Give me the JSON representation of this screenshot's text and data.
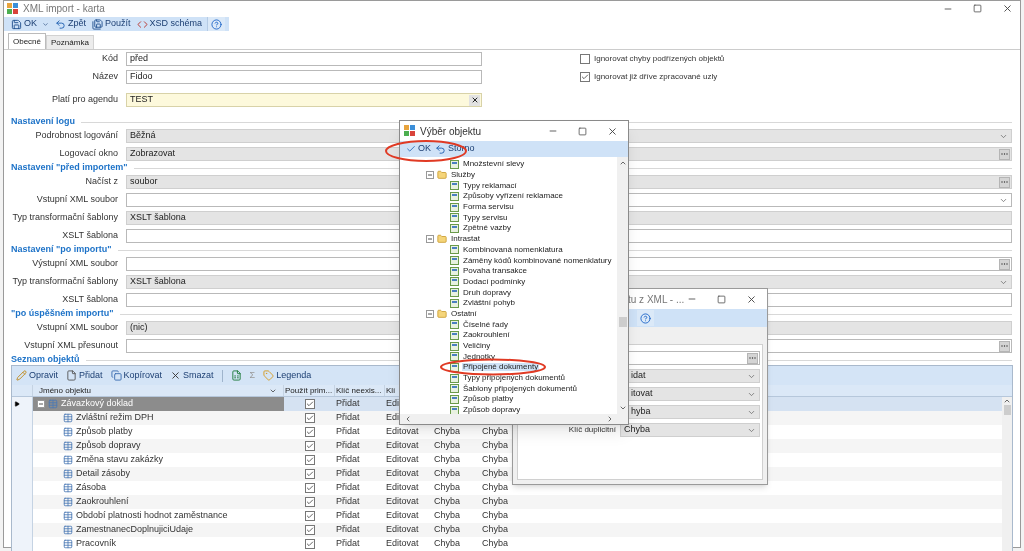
{
  "window": {
    "title": "XML import - karta"
  },
  "toolbar": [
    {
      "kind": "ok",
      "label": "OK",
      "menu": true
    },
    {
      "kind": "back",
      "label": "Zpět"
    },
    {
      "kind": "apply",
      "label": "Použít"
    },
    {
      "kind": "schema",
      "label": "XSD schéma"
    },
    {
      "kind": "help"
    }
  ],
  "tabs": [
    {
      "label": "Obecné",
      "selected": true
    },
    {
      "label": "Poznámka",
      "selected": false
    }
  ],
  "header_fields": [
    {
      "label": "Kód",
      "value": "před",
      "kind": "text"
    },
    {
      "label": "Název",
      "value": "Fidoo",
      "kind": "text"
    },
    {
      "label": "Platí pro agendu",
      "value": "TEST",
      "kind": "agenda"
    }
  ],
  "options": [
    {
      "label": "Ignorovat chyby podřízených objektů",
      "checked": false
    },
    {
      "label": "Ignorovat již dříve zpracované uzly",
      "checked": true
    }
  ],
  "sections": [
    {
      "title": "Nastavení logu",
      "fields": [
        {
          "label": "Podrobnost logování",
          "value": "Běžná",
          "kind": "select",
          "dropdown": true,
          "browse": false
        },
        {
          "label": "Logovací okno",
          "value": "Zobrazovat",
          "kind": "select",
          "dropdown": false,
          "browse": true
        }
      ]
    },
    {
      "title": "Nastavení \"před importem\"",
      "fields": [
        {
          "label": "Načíst z",
          "value": "soubor",
          "kind": "select",
          "dropdown": false,
          "browse": true
        },
        {
          "label": "Vstupní XML soubor",
          "kind": "text",
          "dropdown": true,
          "browse": false
        },
        {
          "label": "Typ transformační šablony",
          "value": "XSLT šablona",
          "kind": "select",
          "dropdown": false,
          "browse": false
        },
        {
          "label": "XSLT šablona",
          "kind": "text",
          "dropdown": false,
          "browse": false
        }
      ]
    },
    {
      "title": "Nastavení \"po importu\"",
      "fields": [
        {
          "label": "Výstupní XML soubor",
          "kind": "text",
          "dropdown": false,
          "browse": true
        },
        {
          "label": "Typ transformační šablony",
          "value": "XSLT šablona",
          "kind": "select",
          "dropdown": true,
          "browse": false
        },
        {
          "label": "XSLT šablona",
          "kind": "text",
          "dropdown": false,
          "browse": false
        }
      ]
    },
    {
      "title": "\"po úspěšném importu\"",
      "fields": [
        {
          "label": "Vstupní XML soubor",
          "value": "(nic)",
          "kind": "select",
          "dropdown": false,
          "browse": false
        },
        {
          "label": "Vstupní XML přesunout",
          "kind": "text",
          "dropdown": false,
          "browse": true
        }
      ]
    }
  ],
  "grid": {
    "title": "Seznam objektů",
    "toolbar": [
      {
        "kind": "edit",
        "label": "Opravit"
      },
      {
        "kind": "add",
        "label": "Přidat"
      },
      {
        "kind": "copy",
        "label": "Kopírovat"
      },
      {
        "kind": "delete",
        "label": "Smazat"
      },
      {
        "kind": "excel"
      },
      {
        "kind": "sum",
        "label": "Σ"
      },
      {
        "kind": "legend",
        "label": "Legenda"
      }
    ],
    "columns": [
      "Jméno objektu",
      "Použít prim...",
      "Klíč neexis...",
      "Klí"
    ],
    "rows": [
      {
        "selected": true,
        "expanded": true,
        "use": true,
        "cells": [
          "Závazkový doklad",
          "",
          "Přidat",
          "Edi"
        ],
        "children": [
          {
            "selected": false,
            "use": true,
            "cells": [
              "Zvláštní režim DPH",
              "",
              "Přidat",
              "Edi"
            ]
          },
          {
            "selected": false,
            "use": true,
            "cells": [
              "Způsob platby",
              "",
              "Přidat",
              "Editovat",
              "Chyba",
              "Chyba"
            ]
          },
          {
            "selected": false,
            "use": true,
            "cells": [
              "Způsob dopravy",
              "",
              "Přidat",
              "Editovat",
              "Chyba",
              "Chyba"
            ]
          },
          {
            "selected": false,
            "use": true,
            "cells": [
              "Změna stavu zakázky",
              "",
              "Přidat",
              "Editovat",
              "Chyba",
              "Chyba"
            ]
          },
          {
            "selected": false,
            "use": true,
            "cells": [
              "Detail zásoby",
              "",
              "Přidat",
              "Editovat",
              "Chyba",
              "Chyba"
            ]
          },
          {
            "selected": false,
            "use": true,
            "cells": [
              "Zásoba",
              "",
              "Přidat",
              "Editovat",
              "Chyba",
              "Chyba"
            ]
          },
          {
            "selected": false,
            "use": true,
            "cells": [
              "Zaokrouhlení",
              "",
              "Přidat",
              "Editovat",
              "Chyba",
              "Chyba"
            ]
          },
          {
            "selected": false,
            "use": true,
            "cells": [
              "Období platnosti hodnot zaměstnance",
              "",
              "Přidat",
              "Editovat",
              "Chyba",
              "Chyba"
            ]
          },
          {
            "selected": false,
            "use": true,
            "cells": [
              "ZamestnanecDoplnujiciUdaje",
              "",
              "Přidat",
              "Editovat",
              "Chyba",
              "Chyba"
            ]
          },
          {
            "selected": false,
            "use": true,
            "cells": [
              "Pracovník",
              "",
              "Přidat",
              "Editovat",
              "Chyba",
              "Chyba"
            ]
          }
        ]
      }
    ]
  },
  "second_dialog": {
    "title": "tu z XML - ...",
    "fields": [
      {
        "kind": "browse"
      },
      {
        "kind": "select",
        "value": "idat"
      },
      {
        "kind": "select",
        "value": "itovat"
      },
      {
        "kind": "select",
        "value": "hyba"
      },
      {
        "kind": "select",
        "label": "Klíč duplicitní",
        "value": "Chyba"
      }
    ]
  },
  "dialog": {
    "title": "Výběr objektu",
    "toolbar": [
      {
        "kind": "ok",
        "label": "OK"
      },
      {
        "kind": "cancel",
        "label": "Storno"
      }
    ],
    "tree": [
      {
        "label": "Množstevní slevy",
        "selected": false
      },
      {
        "label": "Služby",
        "selected": false,
        "expanded": true,
        "children": [
          {
            "label": "Typy reklamací",
            "selected": false
          },
          {
            "label": "Způsoby vyřízení reklamace",
            "selected": false
          },
          {
            "label": "Forma servisu",
            "selected": false
          },
          {
            "label": "Typy servisu",
            "selected": false
          },
          {
            "label": "Zpětné vazby",
            "selected": false
          }
        ]
      },
      {
        "label": "Intrastat",
        "selected": false,
        "expanded": true,
        "children": [
          {
            "label": "Kombinovaná nomenklatura",
            "selected": false
          },
          {
            "label": "Záměny kódů kombinované nomenklatury",
            "selected": false
          },
          {
            "label": "Povaha transakce",
            "selected": false
          },
          {
            "label": "Dodací podmínky",
            "selected": false
          },
          {
            "label": "Druh dopravy",
            "selected": false
          },
          {
            "label": "Zvláštní pohyb",
            "selected": false
          }
        ]
      },
      {
        "label": "Ostatní",
        "selected": false,
        "expanded": true,
        "children": [
          {
            "label": "Číselné řady",
            "selected": false
          },
          {
            "label": "Zaokrouhlení",
            "selected": false
          },
          {
            "label": "Veličiny",
            "selected": false
          },
          {
            "label": "Jednotky",
            "selected": false
          },
          {
            "label": "Připojené dokumenty",
            "selected": true
          },
          {
            "label": "Typy připojených dokumentů",
            "selected": false
          },
          {
            "label": "Šablony připojených dokumentů",
            "selected": false
          },
          {
            "label": "Způsob platby",
            "selected": false
          },
          {
            "label": "Způsob dopravy",
            "selected": false
          }
        ]
      }
    ]
  }
}
